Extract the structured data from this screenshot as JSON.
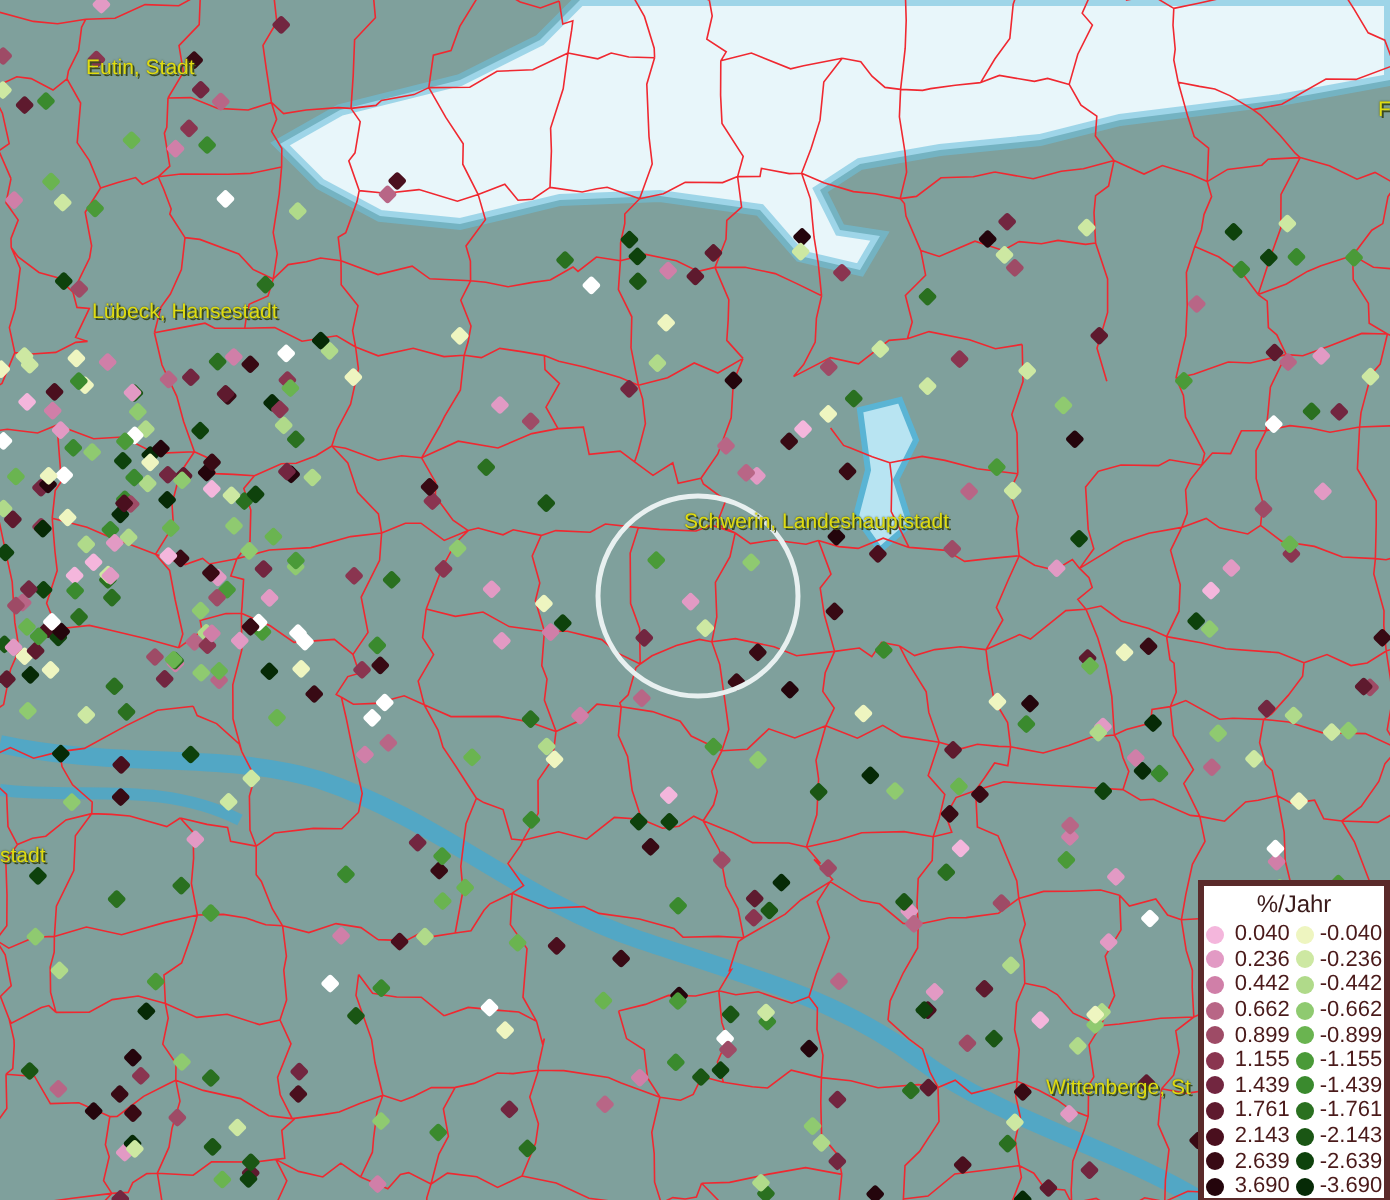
{
  "map": {
    "place_labels": [
      {
        "text": "Eutin, Stadt"
      },
      {
        "text": "Lübeck, Hansestadt"
      },
      {
        "text": "Schwerin, Landeshauptstadt"
      },
      {
        "text": "stadt"
      },
      {
        "text": "Wittenberge, St"
      },
      {
        "text": "F"
      }
    ]
  },
  "legend": {
    "title": "%/Jahr",
    "columns": [
      [
        {
          "label": "0.040",
          "color": "#f4b6dc"
        },
        {
          "label": "0.236",
          "color": "#e29ac4"
        },
        {
          "label": "0.442",
          "color": "#d07fa8"
        },
        {
          "label": "0.662",
          "color": "#b86686"
        },
        {
          "label": "0.899",
          "color": "#9e4b66"
        },
        {
          "label": "1.155",
          "color": "#8a3550"
        },
        {
          "label": "1.439",
          "color": "#722640"
        },
        {
          "label": "1.761",
          "color": "#5e1a2e"
        },
        {
          "label": "2.143",
          "color": "#4a0f1e"
        },
        {
          "label": "2.639",
          "color": "#380a14"
        },
        {
          "label": "3.690",
          "color": "#24050c"
        }
      ],
      [
        {
          "label": "-0.040",
          "color": "#eef5c0"
        },
        {
          "label": "-0.236",
          "color": "#cde8a2"
        },
        {
          "label": "-0.442",
          "color": "#b0da8a"
        },
        {
          "label": "-0.662",
          "color": "#8fca70"
        },
        {
          "label": "-0.899",
          "color": "#6ab450"
        },
        {
          "label": "-1.155",
          "color": "#4a9a38"
        },
        {
          "label": "-1.439",
          "color": "#3a8a2e"
        },
        {
          "label": "-1.761",
          "color": "#2a7020"
        },
        {
          "label": "-2.143",
          "color": "#1a5614"
        },
        {
          "label": "-2.639",
          "color": "#0e420c"
        },
        {
          "label": "-3.690",
          "color": "#062a06"
        }
      ]
    ]
  }
}
